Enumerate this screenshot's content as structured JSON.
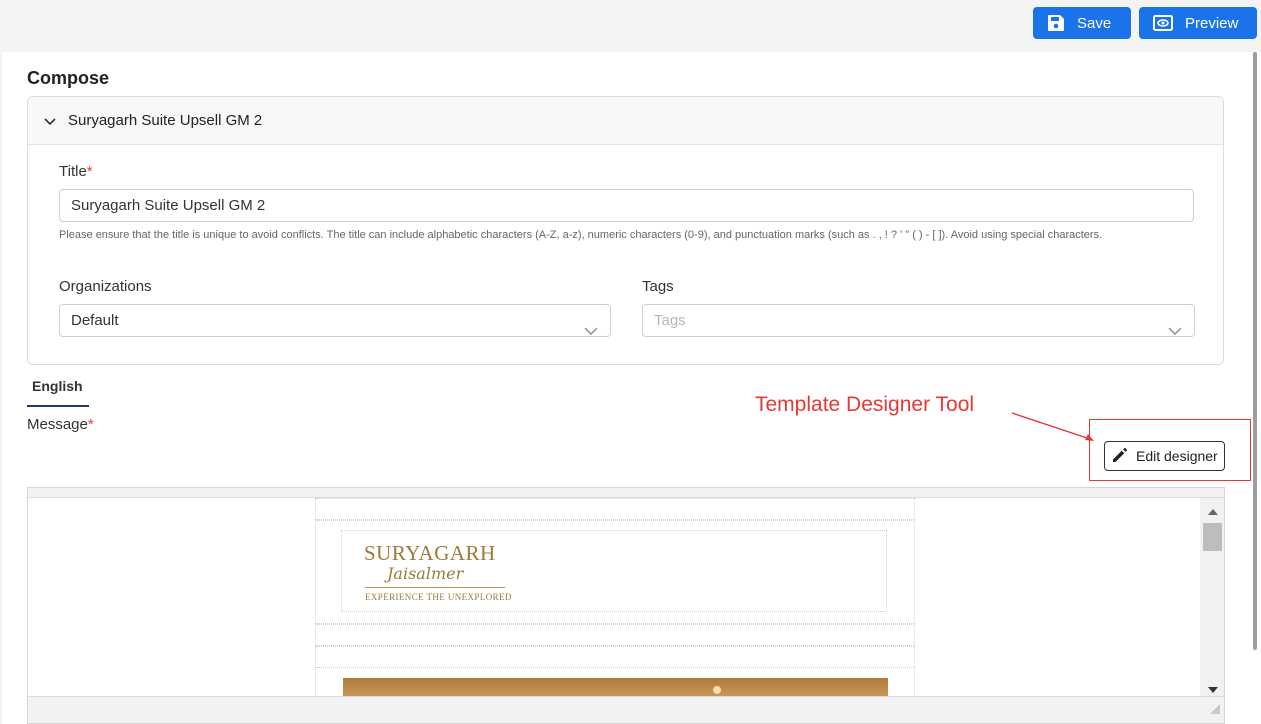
{
  "toolbar": {
    "save_label": "Save",
    "preview_label": "Preview",
    "accent_color": "#1a73e8"
  },
  "compose": {
    "heading": "Compose",
    "card_title": "Suryagarh Suite Upsell GM 2",
    "title_label": "Title",
    "required_mark": "*",
    "title_value": "Suryagarh Suite Upsell GM 2",
    "title_help": "Please ensure that the title is unique to avoid conflicts. The title can include alphabetic characters (A-Z, a-z), numeric characters (0-9), and punctuation marks (such as . , ! ? ' \" ( ) - [ ]). Avoid using special characters.",
    "organizations_label": "Organizations",
    "organizations_value": "Default",
    "tags_label": "Tags",
    "tags_placeholder": "Tags"
  },
  "language_tab": "English",
  "message_label": "Message",
  "annotation": {
    "text": "Template Designer Tool",
    "color": "#e53935"
  },
  "edit_designer_label": "Edit designer",
  "email_preview": {
    "brand_name": "SURYAGARH",
    "brand_script": "Jaisalmer",
    "brand_tagline": "EXPERIENCE THE UNEXPLORED"
  },
  "icons": [
    "save-icon",
    "eye-icon",
    "chevron-down-icon",
    "pencil-icon",
    "scroll-up-icon",
    "scroll-down-icon",
    "resize-grip-icon"
  ]
}
